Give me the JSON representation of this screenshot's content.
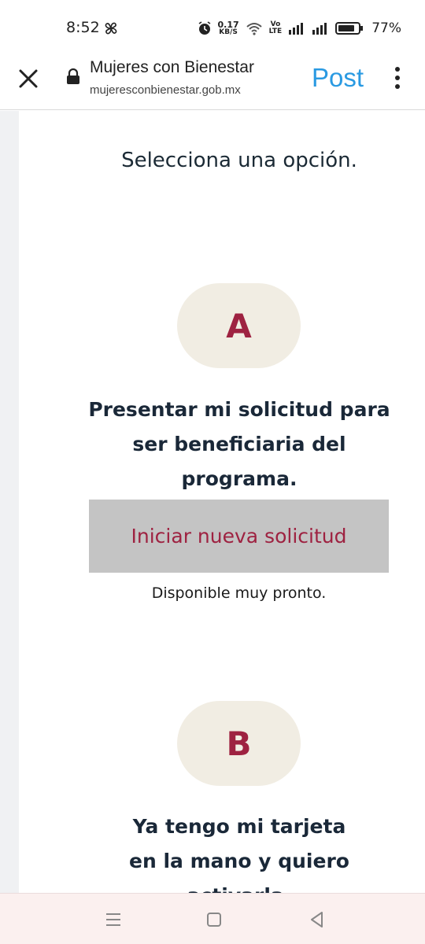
{
  "status_bar": {
    "time": "8:52",
    "network_speed_value": "0.17",
    "network_speed_unit": "KB/S",
    "volte_top": "Vo",
    "volte_bottom": "LTE",
    "battery_percent": "77%"
  },
  "browser": {
    "site_title": "Mujeres con Bienestar",
    "site_url": "mujeresconbienestar.gob.mx",
    "post_label": "Post"
  },
  "page": {
    "heading": "Selecciona una opción.",
    "option_a": {
      "letter": "A",
      "title_lines": [
        "Presentar mi solicitud para",
        "ser beneficiaria del",
        "programa."
      ],
      "button_label": "Iniciar nueva solicitud",
      "availability_note": "Disponible muy pronto."
    },
    "option_b": {
      "letter": "B",
      "title_lines": [
        "Ya tengo mi tarjeta",
        "en la mano y quiero",
        "activarla."
      ]
    }
  },
  "colors": {
    "accent_maroon": "#9e2241",
    "pill_beige": "#f1ede3",
    "button_gray": "#c4c4c4",
    "link_blue": "#2a9ae2"
  }
}
